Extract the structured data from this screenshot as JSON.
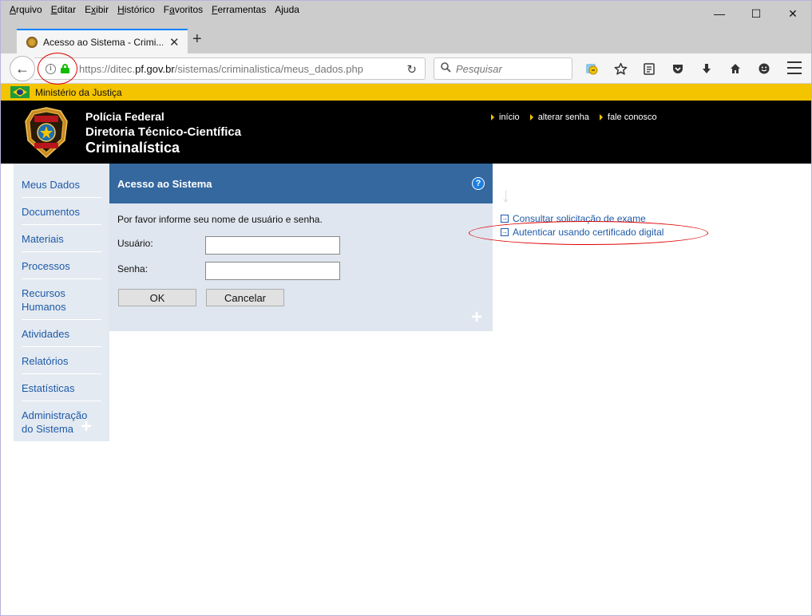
{
  "menubar": {
    "items": [
      {
        "label": "Arquivo",
        "key": "A",
        "rest": "rquivo"
      },
      {
        "label": "Editar",
        "key": "E",
        "rest": "ditar"
      },
      {
        "label": "Exibir",
        "key": "x",
        "rest": "ibir",
        "pre": "E"
      },
      {
        "label": "Histórico",
        "key": "H",
        "rest": "istórico"
      },
      {
        "label": "Favoritos",
        "key": "a",
        "rest": "voritos",
        "pre": "F"
      },
      {
        "label": "Ferramentas",
        "key": "F",
        "rest": "erramentas"
      },
      {
        "label": "Ajuda",
        "key": "j",
        "rest": "uda",
        "pre": "A"
      }
    ]
  },
  "window_controls": {
    "minimize": "—",
    "maximize": "☐",
    "close": "✕"
  },
  "tab": {
    "title": "Acesso ao Sistema - Crimi...",
    "close": "✕"
  },
  "newtab": "+",
  "navbar": {
    "back": "←",
    "info": "i",
    "url_prefix": "https://ditec.",
    "url_domain": "pf.gov.br",
    "url_path": "/sistemas/criminalistica/meus_dados.php",
    "reload": "↻",
    "search_placeholder": "Pesquisar",
    "search_icon": "🔍"
  },
  "toolbar_icons": [
    "extension-icon",
    "star-icon",
    "reading-list-icon",
    "pocket-icon",
    "download-icon",
    "home-icon",
    "emoji-icon"
  ],
  "govbar": {
    "label": "Ministério da Justiça"
  },
  "header": {
    "line1": "Polícia Federal",
    "line2": "Diretoria Técnico-Científica",
    "line3": "Criminalística",
    "links": [
      {
        "label": "início"
      },
      {
        "label": "alterar senha"
      },
      {
        "label": "fale conosco"
      }
    ]
  },
  "sidebar": {
    "items": [
      {
        "label": "Meus Dados"
      },
      {
        "label": "Documentos"
      },
      {
        "label": "Materiais"
      },
      {
        "label": "Processos"
      },
      {
        "label": "Recursos Humanos"
      },
      {
        "label": "Atividades"
      },
      {
        "label": "Relatórios"
      },
      {
        "label": "Estatísticas"
      },
      {
        "label": "Administração do Sistema"
      }
    ]
  },
  "panel": {
    "title": "Acesso ao Sistema",
    "help": "?",
    "intro": "Por favor informe seu nome de usuário e senha.",
    "user_label": "Usuário:",
    "user_value": "",
    "pass_label": "Senha:",
    "pass_value": "",
    "ok_label": "OK",
    "cancel_label": "Cancelar"
  },
  "right_links": [
    {
      "label": "Consultar solicitação de exame"
    },
    {
      "label": "Autenticar usando certificado digital"
    }
  ],
  "colors": {
    "govbar": "#f5c400",
    "header": "#000000",
    "panel_head": "#35689f",
    "panel_body": "#dfe6ef",
    "link": "#1e5aa8",
    "annotation": "#e00000"
  }
}
